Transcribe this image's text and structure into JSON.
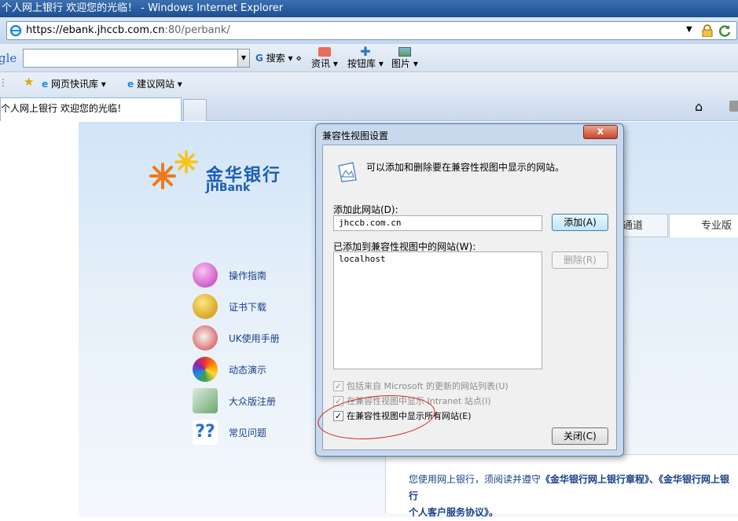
{
  "window": {
    "title": "个人网上银行 欢迎您的光临！ - Windows Internet Explorer"
  },
  "address": {
    "url_main": "https://ebank.jhccb.com.cn",
    "url_rest": ":80/perbank/"
  },
  "google_bar": {
    "logo": "gle",
    "search_label": "搜索",
    "tools": [
      {
        "label": "资讯"
      },
      {
        "label": "按钮库"
      },
      {
        "label": "图片"
      }
    ]
  },
  "favorites": {
    "items": [
      {
        "label": "网页快讯库"
      },
      {
        "label": "建议网站"
      }
    ]
  },
  "tab": {
    "label": "个人网上银行 欢迎您的光临！"
  },
  "bank": {
    "name_cn": "金华银行",
    "name_en": "JHBank",
    "menu": [
      {
        "label": "操作指南"
      },
      {
        "label": "证书下载"
      },
      {
        "label": "UK使用手册"
      },
      {
        "label": "动态演示"
      },
      {
        "label": "大众版注册"
      },
      {
        "label": "常见问题"
      }
    ],
    "tabs": [
      {
        "label": "通道"
      },
      {
        "label": "专业版"
      }
    ],
    "notice": {
      "prefix": "您使用网上银行，须阅读并遵守",
      "doc1": "《金华银行网上银行章程》",
      "mid": "、",
      "doc2": "《金华银行网上银行",
      "doc3": "个人客户服务协议》",
      "suffix": "。"
    }
  },
  "dialog": {
    "title": "兼容性视图设置",
    "close": "x",
    "header": "可以添加和删除要在兼容性视图中显示的网站。",
    "add_label": "添加此网站(D):",
    "add_value": "jhccb.com.cn",
    "add_button": "添加(A)",
    "list_label": "已添加到兼容性视图中的网站(W):",
    "list": [
      "localhost"
    ],
    "remove_button": "删除(R)",
    "options": [
      {
        "label": "包括来自 Microsoft 的更新的网站列表(U)",
        "checked": true,
        "enabled": false
      },
      {
        "label": "在兼容性视图中显示 Intranet 站点(I)",
        "checked": true,
        "enabled": false
      },
      {
        "label": "在兼容性视图中显示所有网站(E)",
        "checked": true,
        "enabled": true
      }
    ],
    "close_button": "关闭(C)"
  }
}
